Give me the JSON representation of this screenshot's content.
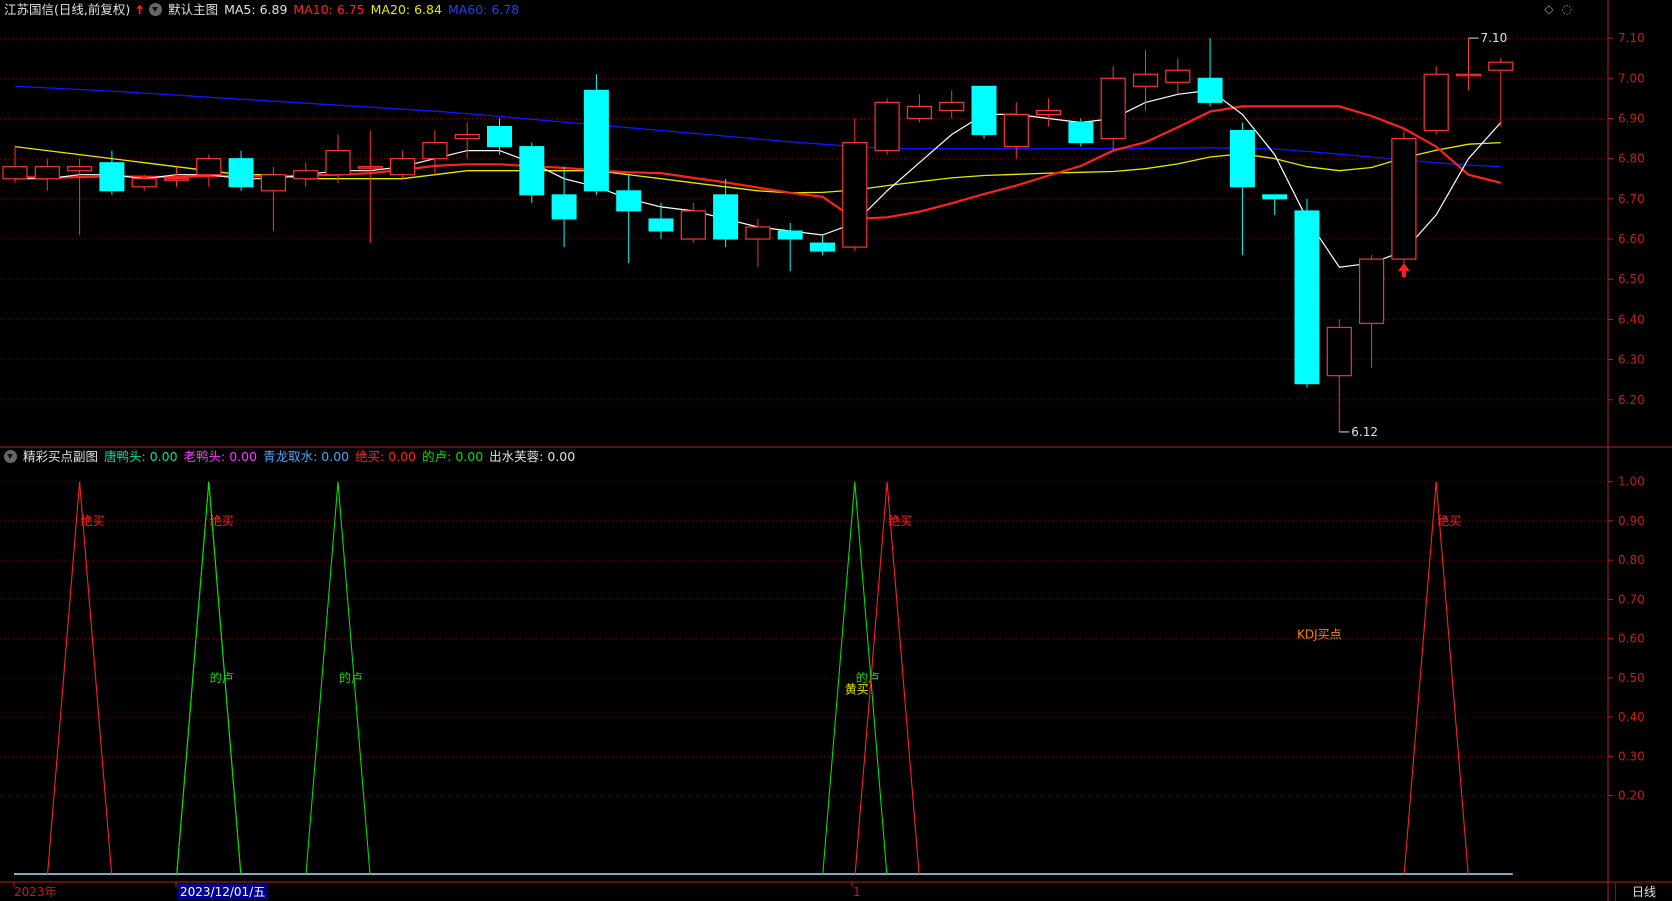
{
  "main_header": {
    "stock": "江苏国信(日线,前复权)",
    "template": "默认主图",
    "ma5": "MA5: 6.89",
    "ma10": "MA10: 6.75",
    "ma20": "MA20: 6.84",
    "ma60": "MA60: 6.78"
  },
  "sub_header": {
    "title": "精彩买点副图",
    "ind1": "唐鸭头: 0.00",
    "ind2": "老鸭头: 0.00",
    "ind3": "青龙取水: 0.00",
    "ind4": "绝买: 0.00",
    "ind5": "的卢: 0.00",
    "ind6": "出水芙蓉: 0.00"
  },
  "footer": {
    "year": "2023年",
    "cursor_date": "2023/12/01/五",
    "month_mark": "1",
    "period": "日线"
  },
  "colors": {
    "up": "#ff3232",
    "down": "#00ffff",
    "ma5": "#ffffff",
    "ma10": "#ff2020",
    "ma20": "#e8e800",
    "ma60": "#1414ff",
    "grid": "#7a0000",
    "axis": "#c81a1a",
    "ind_green": "#00e000",
    "ind_yellow": "#e8e800",
    "ind_blue": "#4da6ff",
    "ind_magenta": "#ff33ff",
    "kdj": "#ff8000"
  },
  "icons": [
    "settings-circle-icon",
    "up-arrow-icon",
    "diamond-icon",
    "pin-icon"
  ],
  "chart_data": [
    {
      "type": "candlestick",
      "ylim": [
        6.09,
        7.14
      ],
      "yticks": [
        "7.10",
        "7.00",
        "6.90",
        "6.80",
        "6.70",
        "6.60",
        "6.50",
        "6.40",
        "6.30",
        "6.20"
      ],
      "candles": [
        [
          6.75,
          6.78,
          6.83,
          6.74
        ],
        [
          6.75,
          6.78,
          6.8,
          6.72
        ],
        [
          6.77,
          6.78,
          6.8,
          6.61
        ],
        [
          6.79,
          6.72,
          6.82,
          6.71
        ],
        [
          6.73,
          6.75,
          6.76,
          6.72
        ],
        [
          6.75,
          6.75,
          6.78,
          6.73
        ],
        [
          6.76,
          6.8,
          6.81,
          6.73
        ],
        [
          6.8,
          6.73,
          6.82,
          6.72
        ],
        [
          6.72,
          6.76,
          6.78,
          6.62
        ],
        [
          6.75,
          6.77,
          6.79,
          6.73
        ],
        [
          6.76,
          6.82,
          6.86,
          6.74
        ],
        [
          6.78,
          6.78,
          6.87,
          6.59
        ],
        [
          6.76,
          6.8,
          6.82,
          6.75
        ],
        [
          6.8,
          6.84,
          6.87,
          6.76
        ],
        [
          6.85,
          6.86,
          6.89,
          6.8
        ],
        [
          6.88,
          6.83,
          6.9,
          6.81
        ],
        [
          6.83,
          6.71,
          6.84,
          6.69
        ],
        [
          6.71,
          6.65,
          6.78,
          6.58
        ],
        [
          6.97,
          6.72,
          7.01,
          6.71
        ],
        [
          6.72,
          6.67,
          6.76,
          6.54
        ],
        [
          6.65,
          6.62,
          6.69,
          6.6
        ],
        [
          6.6,
          6.67,
          6.69,
          6.59
        ],
        [
          6.71,
          6.6,
          6.75,
          6.58
        ],
        [
          6.6,
          6.63,
          6.65,
          6.53
        ],
        [
          6.62,
          6.6,
          6.64,
          6.52
        ],
        [
          6.59,
          6.57,
          6.61,
          6.56
        ],
        [
          6.58,
          6.84,
          6.9,
          6.57
        ],
        [
          6.82,
          6.94,
          6.95,
          6.81
        ],
        [
          6.9,
          6.93,
          6.96,
          6.89
        ],
        [
          6.92,
          6.94,
          6.97,
          6.9
        ],
        [
          6.98,
          6.86,
          6.98,
          6.85
        ],
        [
          6.83,
          6.91,
          6.94,
          6.8
        ],
        [
          6.91,
          6.92,
          6.95,
          6.88
        ],
        [
          6.89,
          6.84,
          6.9,
          6.83
        ],
        [
          6.85,
          7.0,
          7.03,
          6.82
        ],
        [
          6.98,
          7.01,
          7.07,
          6.92
        ],
        [
          6.99,
          7.02,
          7.05,
          6.96
        ],
        [
          7.0,
          6.94,
          7.1,
          6.93
        ],
        [
          6.87,
          6.73,
          6.89,
          6.56
        ],
        [
          6.71,
          6.7,
          6.71,
          6.66
        ],
        [
          6.67,
          6.24,
          6.7,
          6.23
        ],
        [
          6.26,
          6.38,
          6.4,
          6.12
        ],
        [
          6.39,
          6.55,
          6.56,
          6.28
        ],
        [
          6.55,
          6.85,
          6.87,
          6.53
        ],
        [
          6.87,
          7.01,
          7.03,
          6.86
        ],
        [
          7.01,
          7.01,
          7.1,
          6.97
        ],
        [
          7.02,
          7.04,
          7.05,
          6.88
        ]
      ],
      "ma5": [
        6.75,
        6.75,
        6.76,
        6.76,
        6.75,
        6.76,
        6.76,
        6.75,
        6.75,
        6.76,
        6.77,
        6.77,
        6.78,
        6.8,
        6.82,
        6.82,
        6.79,
        6.75,
        6.73,
        6.7,
        6.68,
        6.67,
        6.65,
        6.63,
        6.62,
        6.61,
        6.64,
        6.72,
        6.79,
        6.86,
        6.91,
        6.91,
        6.9,
        6.89,
        6.9,
        6.94,
        6.96,
        6.97,
        6.91,
        6.81,
        6.65,
        6.53,
        6.54,
        6.57,
        6.66,
        6.8,
        6.89
      ],
      "ma10": [
        6.755,
        6.752,
        6.754,
        6.756,
        6.755,
        6.754,
        6.757,
        6.757,
        6.756,
        6.758,
        6.76,
        6.764,
        6.772,
        6.782,
        6.786,
        6.786,
        6.781,
        6.777,
        6.771,
        6.766,
        6.764,
        6.752,
        6.741,
        6.728,
        6.715,
        6.705,
        6.65,
        6.654,
        6.668,
        6.689,
        6.712,
        6.733,
        6.758,
        6.782,
        6.82,
        6.841,
        6.878,
        6.917,
        6.93,
        6.93,
        6.93,
        6.93,
        6.906,
        6.875,
        6.83,
        6.76,
        6.74,
        6.74,
        6.74,
        6.745,
        6.75
      ],
      "ma20": [
        6.83,
        6.82,
        6.81,
        6.8,
        6.79,
        6.78,
        6.77,
        6.76,
        6.76,
        6.75,
        6.75,
        6.75,
        6.75,
        6.76,
        6.77,
        6.77,
        6.77,
        6.77,
        6.77,
        6.76,
        6.75,
        6.74,
        6.73,
        6.72,
        6.715,
        6.716,
        6.722,
        6.733,
        6.743,
        6.752,
        6.758,
        6.761,
        6.764,
        6.766,
        6.768,
        6.775,
        6.787,
        6.804,
        6.812,
        6.8,
        6.78,
        6.77,
        6.778,
        6.802,
        6.821,
        6.836,
        6.84
      ],
      "ma60": [
        6.98,
        6.976,
        6.972,
        6.968,
        6.963,
        6.958,
        6.953,
        6.948,
        6.943,
        6.938,
        6.933,
        6.928,
        6.923,
        6.918,
        6.912,
        6.905,
        6.898,
        6.891,
        6.884,
        6.877,
        6.87,
        6.863,
        6.856,
        6.849,
        6.842,
        6.836,
        6.83,
        6.826,
        6.825,
        6.825,
        6.825,
        6.825,
        6.825,
        6.825,
        6.825,
        6.826,
        6.826,
        6.827,
        6.826,
        6.824,
        6.818,
        6.811,
        6.804,
        6.797,
        6.79,
        6.784,
        6.78
      ],
      "annotations": [
        {
          "text": "7.10",
          "candle": 45,
          "price": 7.1
        },
        {
          "text": "6.12",
          "candle": 41,
          "price": 6.12
        }
      ],
      "buy_arrow": {
        "candle": 43,
        "price": 6.52
      }
    },
    {
      "type": "line",
      "ylim": [
        0.0,
        1.04
      ],
      "yticks": [
        "1.00",
        "0.90",
        "0.80",
        "0.70",
        "0.60",
        "0.50",
        "0.40",
        "0.30",
        "0.20"
      ],
      "spikes": [
        {
          "candle": 2,
          "color": "red",
          "label": "绝买",
          "label_y": 0.9
        },
        {
          "candle": 6,
          "color": "green",
          "label": "绝买",
          "label_y": 0.9,
          "label_color": "red"
        },
        {
          "candle": 6,
          "color": "green",
          "label": "的卢",
          "label_y": 0.5
        },
        {
          "candle": 10,
          "color": "green",
          "label": "的卢",
          "label_y": 0.5
        },
        {
          "candle": 26,
          "color": "green",
          "label": "的卢",
          "label_y": 0.5
        },
        {
          "candle": 27,
          "color": "red",
          "label": "绝买",
          "label_y": 0.9
        },
        {
          "candle": 44,
          "color": "red",
          "label": "绝买",
          "label_y": 0.9
        }
      ],
      "extra_labels": [
        {
          "text": "黄买",
          "candle": 26,
          "y": 0.47,
          "color": "yellow"
        },
        {
          "text": "KDJ买点",
          "candle": 40,
          "y": 0.61,
          "color": "orange"
        }
      ]
    }
  ]
}
